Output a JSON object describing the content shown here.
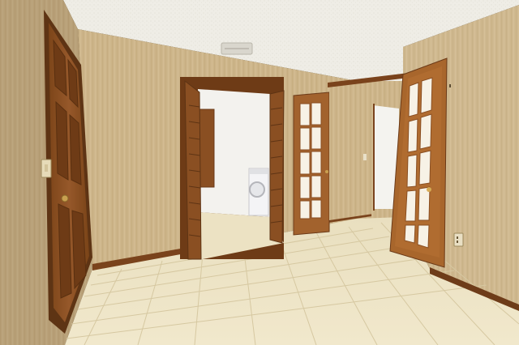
{
  "photo": {
    "subject": "interior-room",
    "colors": {
      "ceiling": "#efede6",
      "wallpaper": "#cdb58a",
      "wallpaper_dark": "#b99c6c",
      "wood_door": "#8a4f22",
      "wood_door_dark": "#6b3a18",
      "trim": "#7a431c",
      "tile": "#ece2c3",
      "tile_grout": "#d4c6a0",
      "laundry_wall": "#f3f2ee",
      "washer": "#f4f4f6",
      "glass": "#f7f2e6"
    }
  }
}
